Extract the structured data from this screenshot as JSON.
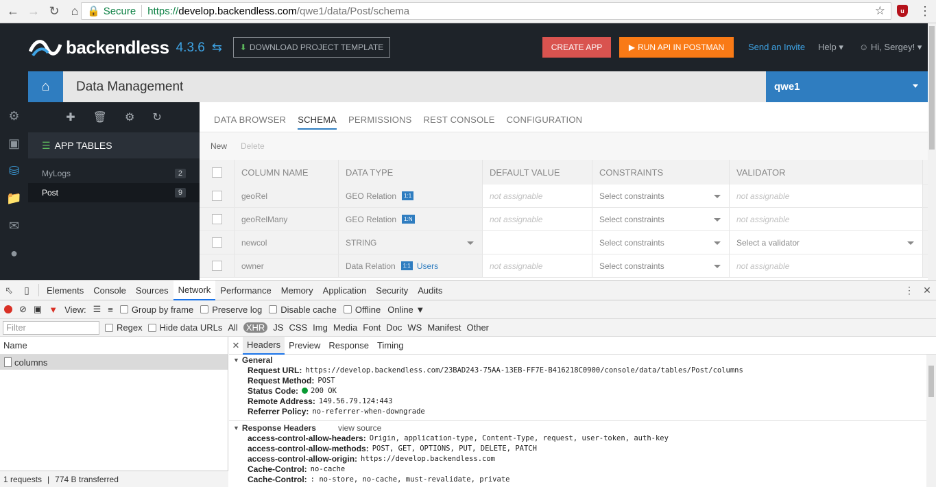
{
  "browser": {
    "secure_label": "Secure",
    "url_proto": "https://",
    "url_host": "develop.backendless.com",
    "url_path": "/qwe1/data/Post/schema"
  },
  "header": {
    "logo_text": "backendless",
    "version": "4.3.6",
    "download_template": "DOWNLOAD PROJECT TEMPLATE",
    "create_app": "CREATE APP",
    "run_api": "RUN API IN POSTMAN",
    "send_invite": "Send an Invite",
    "help": "Help",
    "user": "Hi, Sergey!"
  },
  "titlebar": {
    "title": "Data Management",
    "app_name": "qwe1"
  },
  "tables_panel": {
    "heading": "APP TABLES",
    "items": [
      {
        "name": "MyLogs",
        "count": "2"
      },
      {
        "name": "Post",
        "count": "9"
      }
    ]
  },
  "tabs": [
    "DATA BROWSER",
    "SCHEMA",
    "PERMISSIONS",
    "REST CONSOLE",
    "CONFIGURATION"
  ],
  "actions": {
    "new": "New",
    "delete": "Delete"
  },
  "grid": {
    "headers": [
      "COLUMN NAME",
      "DATA TYPE",
      "DEFAULT VALUE",
      "CONSTRAINTS",
      "VALIDATOR"
    ],
    "rows": [
      {
        "name": "geoRel",
        "type": "GEO Relation",
        "badge": "1:1",
        "default": "not assignable",
        "constraints": "Select constraints",
        "validator": "not assignable"
      },
      {
        "name": "geoRelMany",
        "type": "GEO Relation",
        "badge": "1:N",
        "default": "not assignable",
        "constraints": "Select constraints",
        "validator": "not assignable"
      },
      {
        "name": "newcol",
        "type": "STRING",
        "default": "",
        "constraints": "Select constraints",
        "validator": "Select a validator"
      },
      {
        "name": "owner",
        "type": "Data Relation",
        "badge": "1:1",
        "link": "Users",
        "default": "not assignable",
        "constraints": "Select constraints",
        "validator": "not assignable"
      }
    ]
  },
  "devtools": {
    "tabs": [
      "Elements",
      "Console",
      "Sources",
      "Network",
      "Performance",
      "Memory",
      "Application",
      "Security",
      "Audits"
    ],
    "toolbar": {
      "view": "View:",
      "group_by_frame": "Group by frame",
      "preserve_log": "Preserve log",
      "disable_cache": "Disable cache",
      "offline": "Offline",
      "online": "Online"
    },
    "filter": {
      "placeholder": "Filter",
      "regex": "Regex",
      "hide_data_urls": "Hide data URLs",
      "types": [
        "All",
        "XHR",
        "JS",
        "CSS",
        "Img",
        "Media",
        "Font",
        "Doc",
        "WS",
        "Manifest",
        "Other"
      ]
    },
    "name_header": "Name",
    "request_name": "columns",
    "footer": {
      "requests": "1 requests",
      "transferred": "774 B transferred"
    },
    "detail_tabs": [
      "Headers",
      "Preview",
      "Response",
      "Timing"
    ],
    "general": {
      "title": "General",
      "request_url_k": "Request URL:",
      "request_url_v": "https://develop.backendless.com/23BAD243-75AA-13EB-FF7E-B416218C0900/console/data/tables/Post/columns",
      "method_k": "Request Method:",
      "method_v": "POST",
      "status_k": "Status Code:",
      "status_v": "200 OK",
      "remote_k": "Remote Address:",
      "remote_v": "149.56.79.124:443",
      "referrer_k": "Referrer Policy:",
      "referrer_v": "no-referrer-when-downgrade"
    },
    "response_headers": {
      "title": "Response Headers",
      "view_source": "view source",
      "items": [
        {
          "k": "access-control-allow-headers:",
          "v": "Origin, application-type, Content-Type, request, user-token, auth-key"
        },
        {
          "k": "access-control-allow-methods:",
          "v": "POST, GET, OPTIONS, PUT, DELETE, PATCH"
        },
        {
          "k": "access-control-allow-origin:",
          "v": "https://develop.backendless.com"
        },
        {
          "k": "Cache-Control:",
          "v": "no-cache"
        },
        {
          "k": "Cache-Control:",
          "v": ": no-store, no-cache, must-revalidate, private"
        }
      ]
    }
  },
  "colors": {
    "accent": "#2f7dc0",
    "create": "#d9534f",
    "postman": "#f97a16",
    "dark": "#1e2329",
    "link": "#3ea3e4"
  }
}
